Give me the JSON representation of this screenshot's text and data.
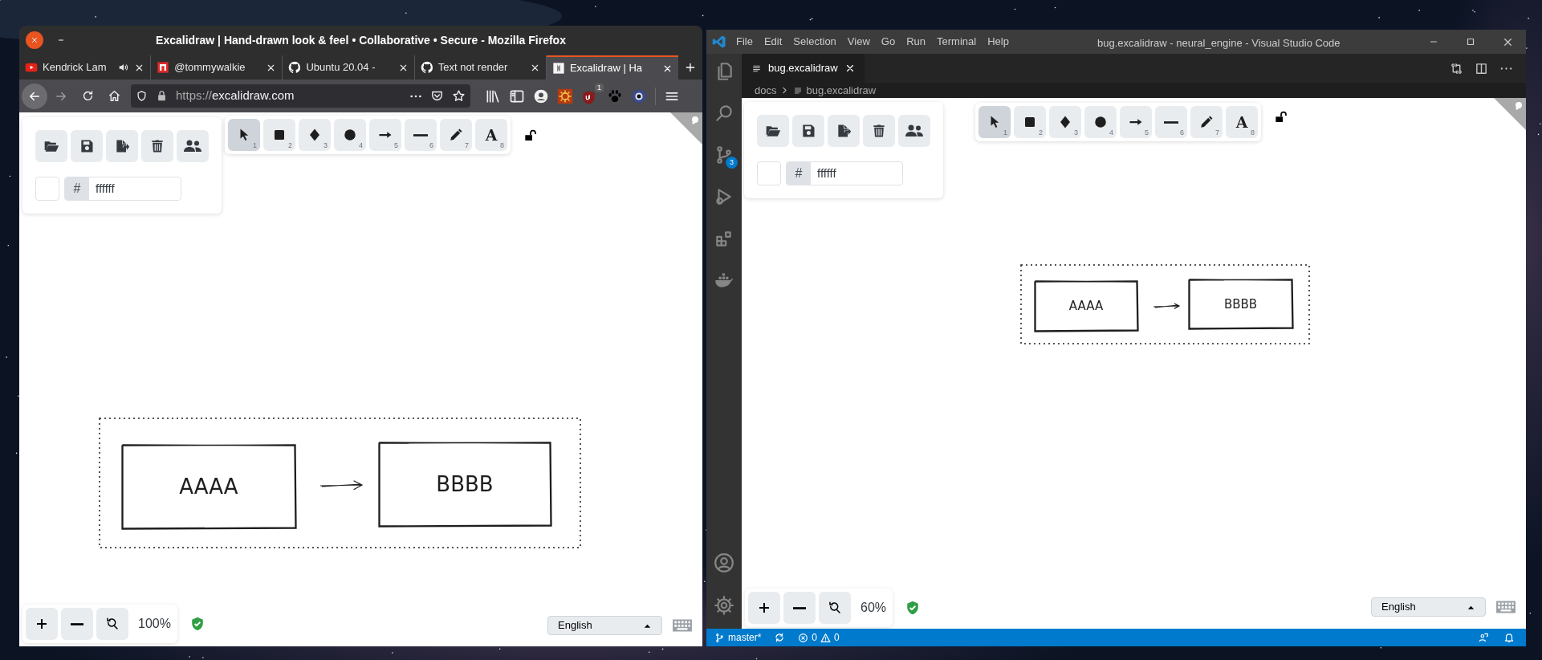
{
  "firefox": {
    "title": "Excalidraw | Hand-drawn look & feel • Collaborative • Secure - Mozilla Firefox",
    "tabs": [
      {
        "label": "Kendrick Lam",
        "selected": false,
        "playing_audio": true
      },
      {
        "label": "@tommywalkie",
        "selected": false,
        "playing_audio": false
      },
      {
        "label": "Ubuntu 20.04 -",
        "selected": false,
        "playing_audio": false
      },
      {
        "label": "Text not render",
        "selected": false,
        "playing_audio": false
      },
      {
        "label": "Excalidraw | Ha",
        "selected": true,
        "playing_audio": false
      }
    ],
    "address_bar": {
      "scheme": "https://",
      "host": "excalidraw.com"
    },
    "extension_badge": "1",
    "excalidraw": {
      "tools": [
        {
          "kind": "selection",
          "key": "1",
          "selected": true
        },
        {
          "kind": "rectangle",
          "key": "2",
          "selected": false
        },
        {
          "kind": "diamond",
          "key": "3",
          "selected": false
        },
        {
          "kind": "ellipse",
          "key": "4",
          "selected": false
        },
        {
          "kind": "arrow",
          "key": "5",
          "selected": false
        },
        {
          "kind": "line",
          "key": "6",
          "selected": false
        },
        {
          "kind": "draw",
          "key": "7",
          "selected": false
        },
        {
          "kind": "text",
          "key": "8",
          "glyph": "A",
          "selected": false
        }
      ],
      "background": {
        "hash": "#",
        "value": "ffffff"
      },
      "zoom": "100%",
      "language": "English",
      "shapes": [
        {
          "kind": "rectangle",
          "label": "AAAA"
        },
        {
          "kind": "arrow"
        },
        {
          "kind": "rectangle",
          "label": "BBBB"
        }
      ]
    }
  },
  "vscode": {
    "menu": [
      "File",
      "Edit",
      "Selection",
      "View",
      "Go",
      "Run",
      "Terminal",
      "Help"
    ],
    "title": "bug.excalidraw - neural_engine - Visual Studio Code",
    "editor_tabs": [
      {
        "label": "bug.excalidraw",
        "selected": true
      }
    ],
    "breadcrumb": [
      "docs",
      "bug.excalidraw"
    ],
    "source_control_badge": "3",
    "excalidraw": {
      "tools": [
        {
          "kind": "selection",
          "key": "1",
          "selected": true
        },
        {
          "kind": "rectangle",
          "key": "2",
          "selected": false
        },
        {
          "kind": "diamond",
          "key": "3",
          "selected": false
        },
        {
          "kind": "ellipse",
          "key": "4",
          "selected": false
        },
        {
          "kind": "arrow",
          "key": "5",
          "selected": false
        },
        {
          "kind": "line",
          "key": "6",
          "selected": false
        },
        {
          "kind": "draw",
          "key": "7",
          "selected": false
        },
        {
          "kind": "text",
          "key": "8",
          "glyph": "A",
          "selected": false
        }
      ],
      "background": {
        "hash": "#",
        "value": "ffffff"
      },
      "zoom": "60%",
      "language": "English",
      "shapes": [
        {
          "kind": "rectangle",
          "label": "AAAA"
        },
        {
          "kind": "arrow"
        },
        {
          "kind": "rectangle",
          "label": "BBBB"
        }
      ]
    },
    "status_bar": {
      "branch": "master*",
      "errors": "0",
      "warnings": "0"
    }
  }
}
